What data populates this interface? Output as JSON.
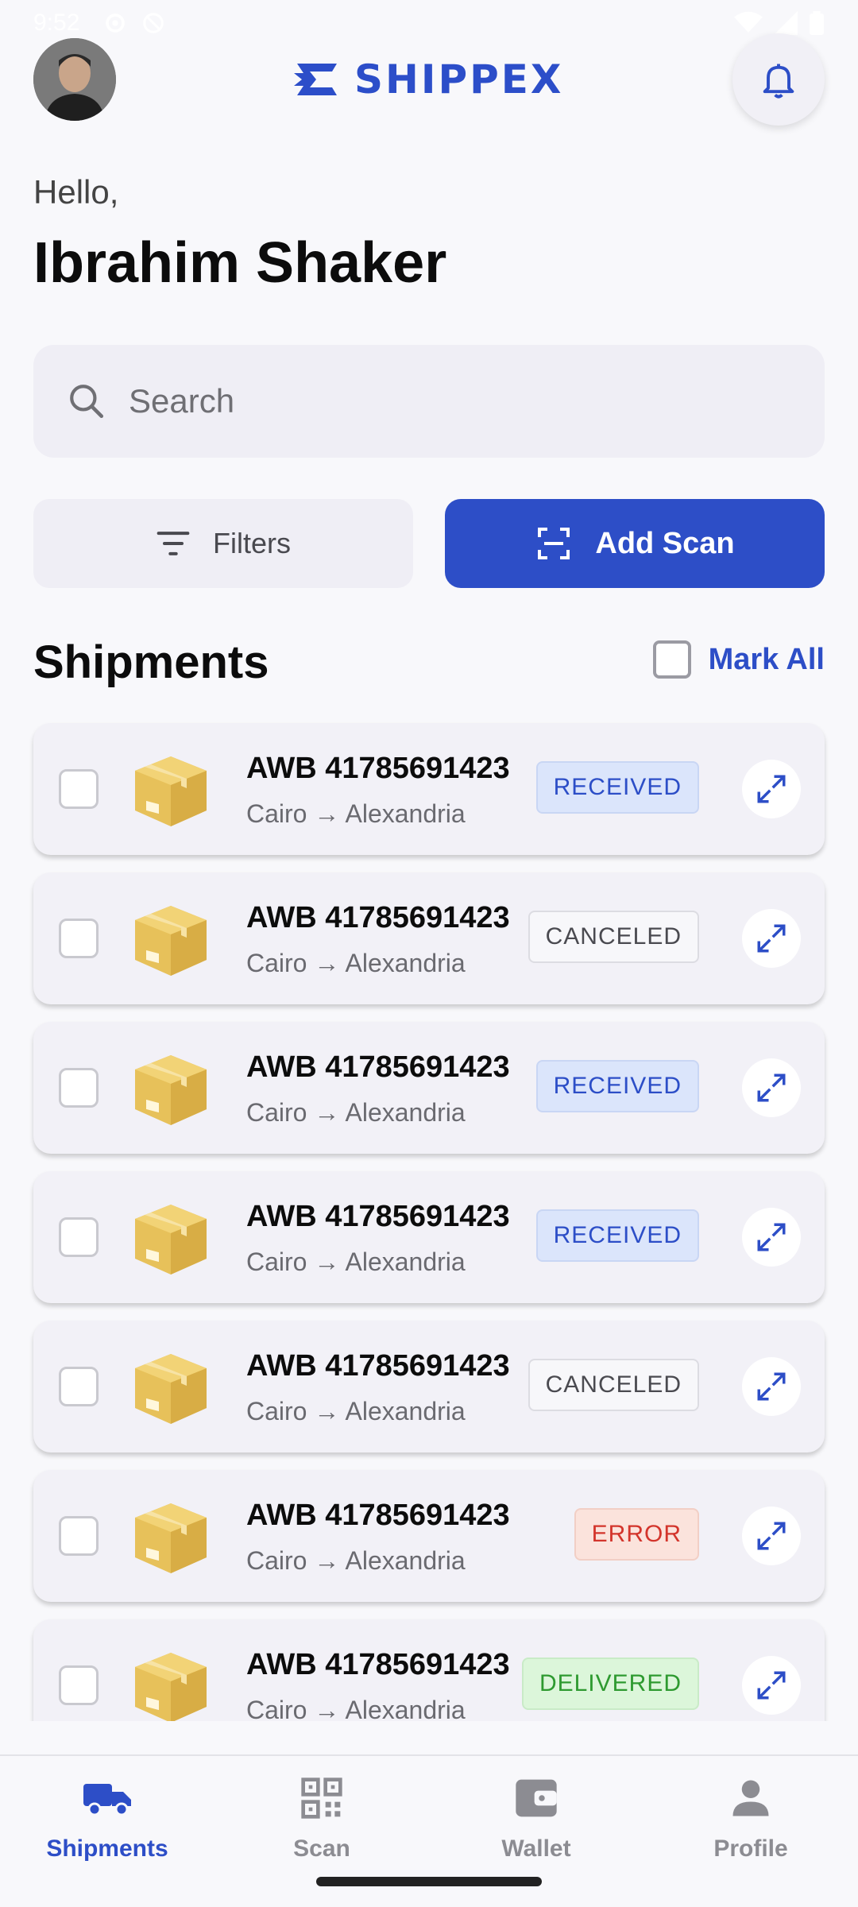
{
  "status_bar": {
    "time": "9:52"
  },
  "header": {
    "brand": "SHIPPEX",
    "avatar_icon": "user-avatar",
    "notification_icon": "bell-icon"
  },
  "greeting": "Hello,",
  "user_name": "Ibrahim Shaker",
  "search": {
    "placeholder": "Search"
  },
  "actions": {
    "filters_label": "Filters",
    "add_scan_label": "Add Scan"
  },
  "shipments": {
    "title": "Shipments",
    "mark_all_label": "Mark All",
    "items": [
      {
        "awb": "AWB 41785691423",
        "route": "Cairo → Alexandria",
        "status": "RECEIVED",
        "status_type": "received"
      },
      {
        "awb": "AWB 41785691423",
        "route": "Cairo → Alexandria",
        "status": "CANCELED",
        "status_type": "canceled"
      },
      {
        "awb": "AWB 41785691423",
        "route": "Cairo → Alexandria",
        "status": "RECEIVED",
        "status_type": "received"
      },
      {
        "awb": "AWB 41785691423",
        "route": "Cairo → Alexandria",
        "status": "RECEIVED",
        "status_type": "received"
      },
      {
        "awb": "AWB 41785691423",
        "route": "Cairo → Alexandria",
        "status": "CANCELED",
        "status_type": "canceled"
      },
      {
        "awb": "AWB 41785691423",
        "route": "Cairo → Alexandria",
        "status": "ERROR",
        "status_type": "error"
      },
      {
        "awb": "AWB 41785691423",
        "route": "Cairo → Alexandria",
        "status": "DELIVERED",
        "status_type": "delivered"
      }
    ]
  },
  "bottom_nav": {
    "items": [
      {
        "label": "Shipments",
        "icon": "truck-icon",
        "active": true
      },
      {
        "label": "Scan",
        "icon": "qr-code-icon",
        "active": false
      },
      {
        "label": "Wallet",
        "icon": "wallet-icon",
        "active": false
      },
      {
        "label": "Profile",
        "icon": "person-icon",
        "active": false
      }
    ]
  },
  "colors": {
    "accent": "#2d4ec7",
    "background": "#f8f8fb"
  }
}
